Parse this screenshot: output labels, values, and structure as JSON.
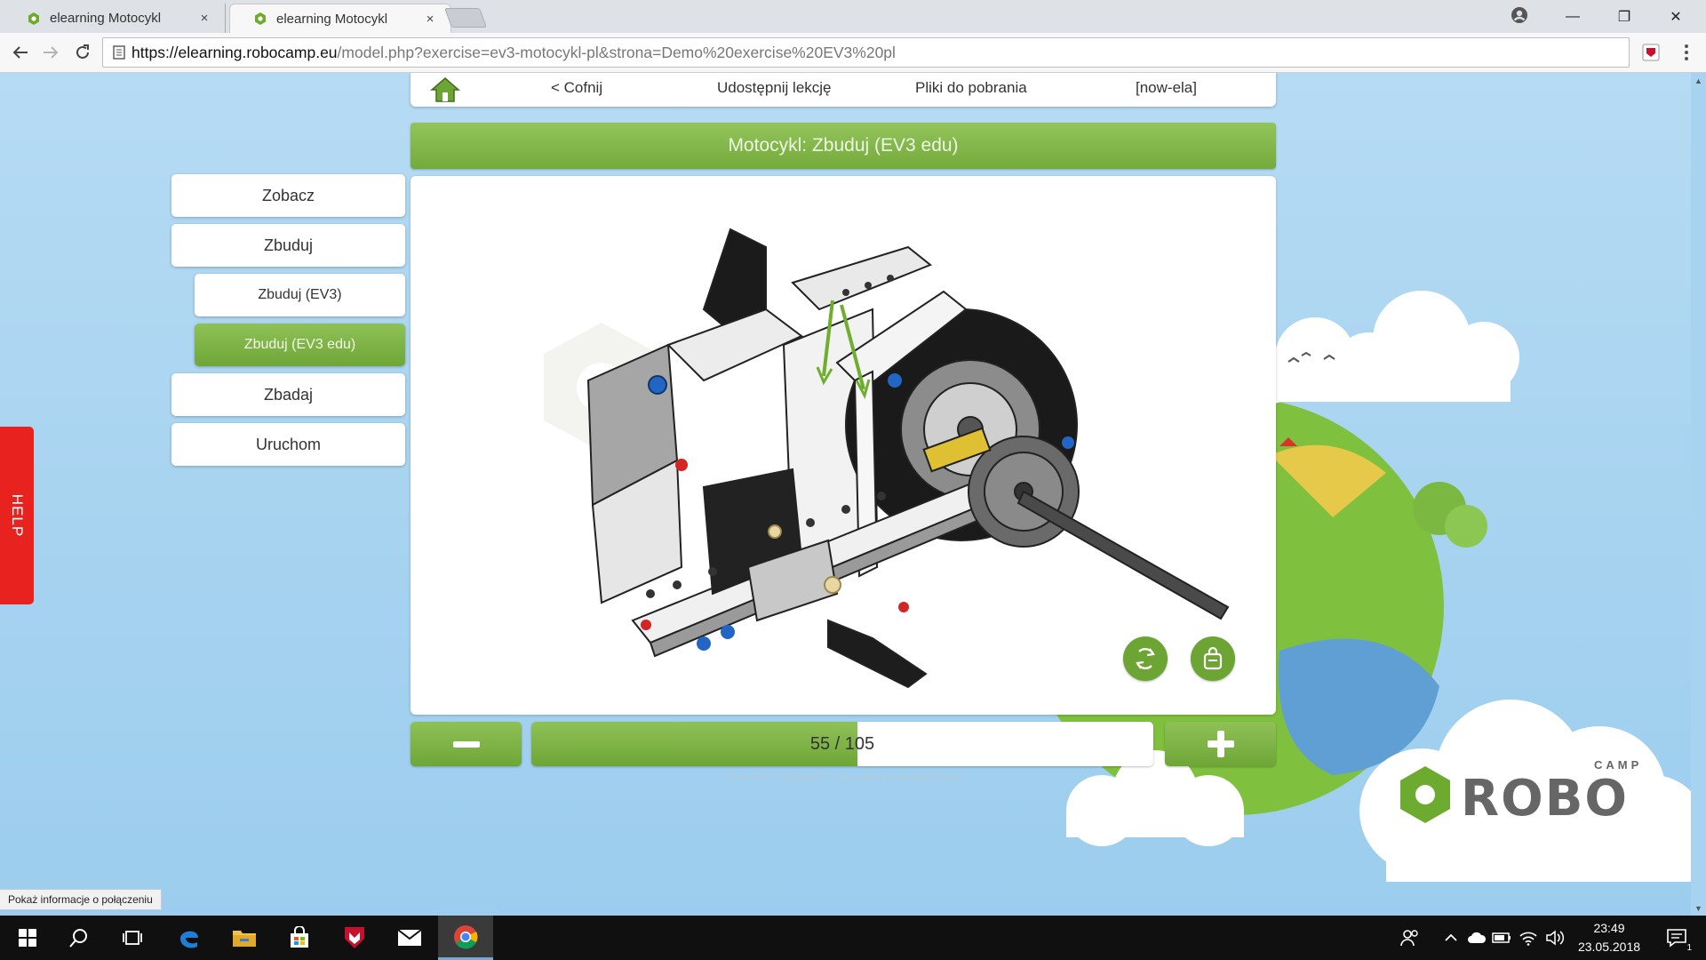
{
  "browser": {
    "tabs": [
      {
        "title": "elearning Motocykl",
        "close": "×"
      },
      {
        "title": "elearning Motocykl",
        "close": "×"
      }
    ],
    "window_controls": {
      "minimize": "—",
      "restore": "❐",
      "close": "✕"
    },
    "url": {
      "host": "https://elearning.robocamp.eu",
      "path": "/model.php?exercise=ev3-motocykl-pl&strona=Demo%20exercise%20EV3%20pl"
    }
  },
  "topnav": {
    "back": "< Cofnij",
    "share": "Udostępnij lekcję",
    "downloads": "Pliki do pobrania",
    "user": "[now-ela]"
  },
  "header": {
    "title": "Motocykl: Zbuduj (EV3 edu)"
  },
  "sidebar": {
    "items": [
      {
        "label": "Zobacz"
      },
      {
        "label": "Zbuduj"
      },
      {
        "label": "Zbuduj (EV3)"
      },
      {
        "label": "Zbuduj (EV3 edu)"
      },
      {
        "label": "Zbadaj"
      },
      {
        "label": "Uruchom"
      }
    ]
  },
  "help": {
    "label": "HELP"
  },
  "viewer": {
    "rotate_icon": "rotate-icon",
    "bag_icon": "parts-bag-icon"
  },
  "stepper": {
    "current": 55,
    "total": 105,
    "label": "55 / 105",
    "progress_fraction": 0.524
  },
  "footer": {
    "copyright": "2014-2016 © RoboNET : Wszystkie prawa zastrzeżone"
  },
  "logo": {
    "text": "ROBO",
    "small": "CAMP"
  },
  "status_bubble": {
    "text": "Pokaż informacje o połączeniu"
  },
  "taskbar": {
    "time": "23:49",
    "date": "23.05.2018",
    "notifications": "1"
  },
  "colors": {
    "accent_green": "#74aa3b",
    "help_red": "#e8231f",
    "sky": "#a7d3f0"
  }
}
